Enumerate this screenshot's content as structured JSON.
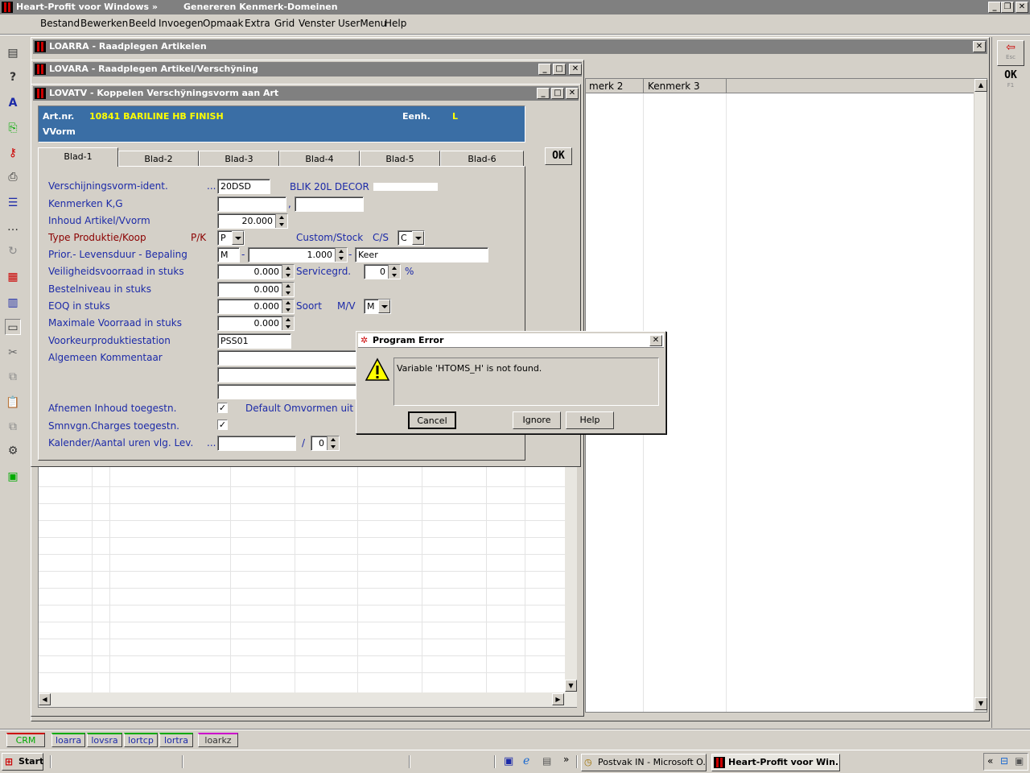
{
  "app": {
    "title": "Heart-Profit voor Windows  »",
    "subtitle": "Genereren Kenmerk-Domeinen"
  },
  "menu": [
    "Bestand",
    "Bewerken",
    "Beeld",
    "Invoegen",
    "Opmaak",
    "Extra",
    "Grid",
    "Venster",
    "UserMenu",
    "Help"
  ],
  "toolbar_right": {
    "esc_label": "Esc",
    "ok_label": "OK",
    "f1_label": "F1"
  },
  "win_loarra": {
    "title": "LOARRA - Raadplegen Artikelen",
    "col2": "merk 2",
    "col3": "Kenmerk 3"
  },
  "win_lovara": {
    "title": "LOVARA - Raadplegen Artikel/Verschÿning"
  },
  "win_lovatv": {
    "title": "LOVATV - Koppelen Verschÿningsvorm aan Art",
    "header": {
      "artnr_label": "Art.nr.",
      "artnr_value": "10841  BARILINE HB FINISH",
      "eenh_label": "Eenh.",
      "eenh_value": "L",
      "vvorm_label": "VVorm"
    },
    "ok_button": "OK",
    "tabs": [
      "Blad-1",
      "Blad-2",
      "Blad-3",
      "Blad-4",
      "Blad-5",
      "Blad-6"
    ],
    "form": {
      "verschijning_label": "Verschijningsvorm-ident.",
      "ellipsis": "...",
      "verschijning_value": "20DSD",
      "verschijning_desc": "BLIK 20L DECOR",
      "kenmerken_label": "Kenmerken K,G",
      "comma": ",",
      "inhoud_label": "Inhoud Artikel/Vvorm",
      "inhoud_value": "20.000",
      "type_label": "Type Produktie/Koop",
      "pk_label": "P/K",
      "pk_value": "P",
      "custom_label": "Custom/Stock",
      "cs_label": "C/S",
      "cs_value": "C",
      "prior_label": "Prior.- Levensduur - Bepaling",
      "prior_value": "M",
      "dash": "-",
      "levensduur_value": "1.000",
      "bepaling_value": "Keer",
      "veiligheid_label": "Veiligheidsvoorraad in stuks",
      "veiligheid_value": "0.000",
      "servicegrd_label": "Servicegrd.",
      "servicegrd_value": "0",
      "percent": "%",
      "bestel_label": "Bestelniveau in stuks",
      "bestel_value": "0.000",
      "eoq_label": "EOQ in stuks",
      "eoq_value": "0.000",
      "soort_label": "Soort",
      "mv_label": "M/V",
      "mv_value": "M",
      "max_label": "Maximale Voorraad in stuks",
      "max_value": "0.000",
      "voorkeur_label": "Voorkeurproduktiestation",
      "voorkeur_value": "PSS01",
      "kommentaar_label": "Algemeen Kommentaar",
      "afnemen_label": "Afnemen Inhoud toegestn.",
      "default_label": "Default Omvormen uit V",
      "smnvgn_label": "Smnvgn.Charges toegestn.",
      "kalender_label": "Kalender/Aantal uren vlg. Lev.",
      "slash": "/",
      "kalender_uren": "0",
      "checkmark": "✓"
    }
  },
  "dialog": {
    "title": "Program Error",
    "message": "Variable 'HTOMS_H' is not found.",
    "cancel": "Cancel",
    "ignore": "Ignore",
    "help": "Help"
  },
  "bottom_tabs": [
    "CRM",
    "loarra",
    "lovsra",
    "lortcp",
    "lortra",
    "loarkz"
  ],
  "taskbar": {
    "start": "Start",
    "chevron": "»",
    "task1": "Postvak IN - Microsoft O...",
    "task2": "Heart-Profit voor Win...",
    "tray_chevron": "«"
  }
}
